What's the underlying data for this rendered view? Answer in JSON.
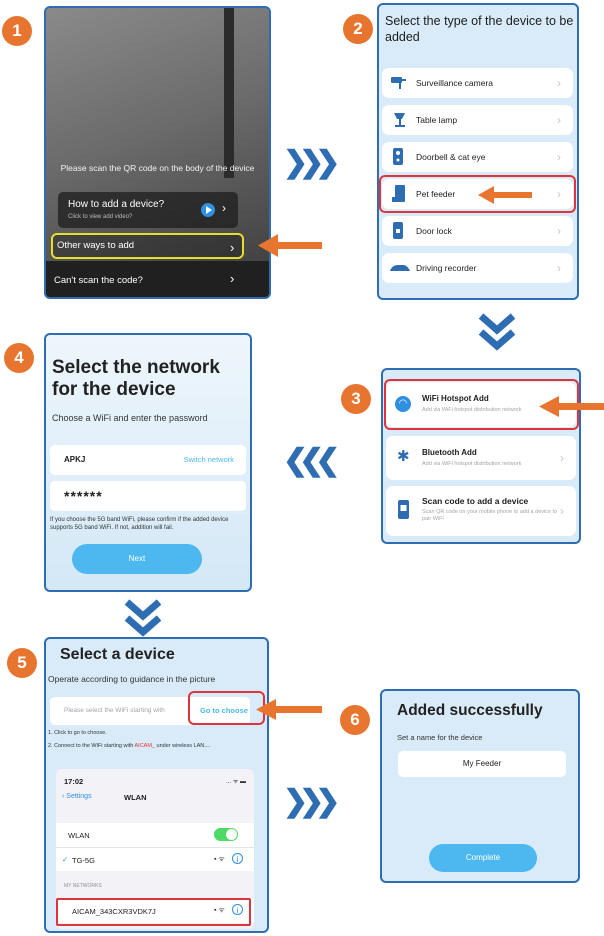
{
  "steps": {
    "n1": "1",
    "n2": "2",
    "n3": "3",
    "n4": "4",
    "n5": "5",
    "n6": "6"
  },
  "s1": {
    "hint": "Please scan the QR code on the body of the device",
    "how_title": "How to add a device?",
    "how_sub": "Click to view add video?",
    "other": "Other ways to add",
    "cant": "Can't scan the code?"
  },
  "s2": {
    "title": "Select the type of the device to be added",
    "items": [
      "Surveillance camera",
      "Table lamp",
      "Doorbell & cat eye",
      "Pet feeder",
      "Door lock",
      "Driving recorder"
    ]
  },
  "s3": {
    "items": [
      {
        "title": "WiFi Hotspot Add",
        "sub": "Add via WiFi hotspot distribution network"
      },
      {
        "title": "Bluetooth Add",
        "sub": "Add via WiFi hotspot distribution network"
      },
      {
        "title": "Scan code to add a device",
        "sub": "Scan QR code on your mobile phone to add a device to pair WiFi"
      }
    ]
  },
  "s4": {
    "title": "Select the network for the device",
    "subtitle": "Choose a WiFi and enter the password",
    "ssid": "APKJ",
    "switch": "Switch network",
    "password": "******",
    "note": "If you choose the 5G band WiFi, please confirm if the added device supports 5G band WiFi. If not, addition will fail.",
    "next": "Next"
  },
  "s5": {
    "title": "Select a device",
    "subtitle": "Operate according to guidance in the picture",
    "placeholder": "Please select the WiFi starting with",
    "go": "Go to choose",
    "step1": "1. Click to go to choose.",
    "step2_pre": "2. Connect to the WiFi starting with ",
    "step2_hl": "AICAM_",
    "step2_post": " under wireless LAN....",
    "time": "17:02",
    "status": "... ᯤ ▬",
    "back": "Settings",
    "nav_title": "WLAN",
    "wlan": "WLAN",
    "current": "TG-5G",
    "section": "MY NETWORKS",
    "network": "AICAM_343CXR3VDK7J"
  },
  "s6": {
    "title": "Added successfully",
    "label": "Set a name for the device",
    "name": "My Feeder",
    "complete": "Complete"
  },
  "colors": {
    "accent": "#2f6db2",
    "orange": "#e8752f",
    "red": "#e0343c",
    "blue_btn": "#4db8ef",
    "yellow": "#e8dd2a"
  }
}
